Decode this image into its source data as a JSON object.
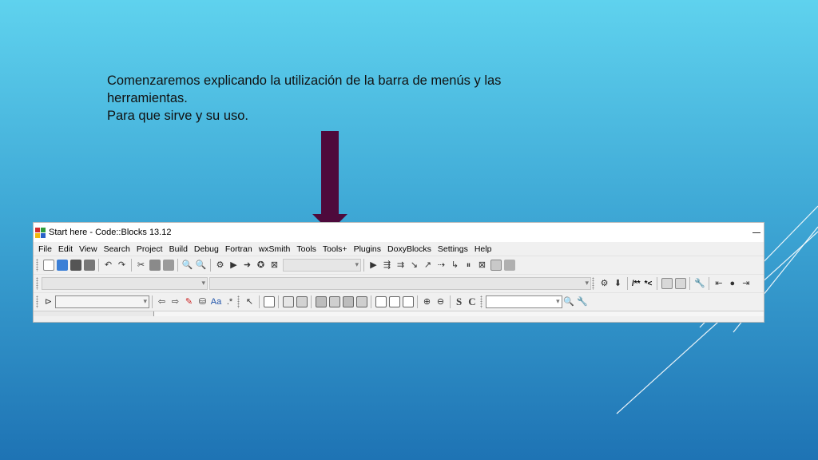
{
  "caption": {
    "line1": "Comenzaremos explicando la utilización de la barra de menús y las",
    "line2": "herramientas.",
    "line3": "Para que sirve y su uso."
  },
  "colors": {
    "arrow": "#4e0a3c",
    "background_top": "#5fd2ee",
    "background_bottom": "#1e73b4"
  },
  "window": {
    "title": "Start here - Code::Blocks 13.12",
    "menus": [
      "File",
      "Edit",
      "View",
      "Search",
      "Project",
      "Build",
      "Debug",
      "Fortran",
      "wxSmith",
      "Tools",
      "Tools+",
      "Plugins",
      "DoxyBlocks",
      "Settings",
      "Help"
    ]
  },
  "toolbar": {
    "doxy_comment_block": "/**",
    "doxy_line_comment": "*<",
    "regex_s": "S",
    "regex_c": "C"
  }
}
